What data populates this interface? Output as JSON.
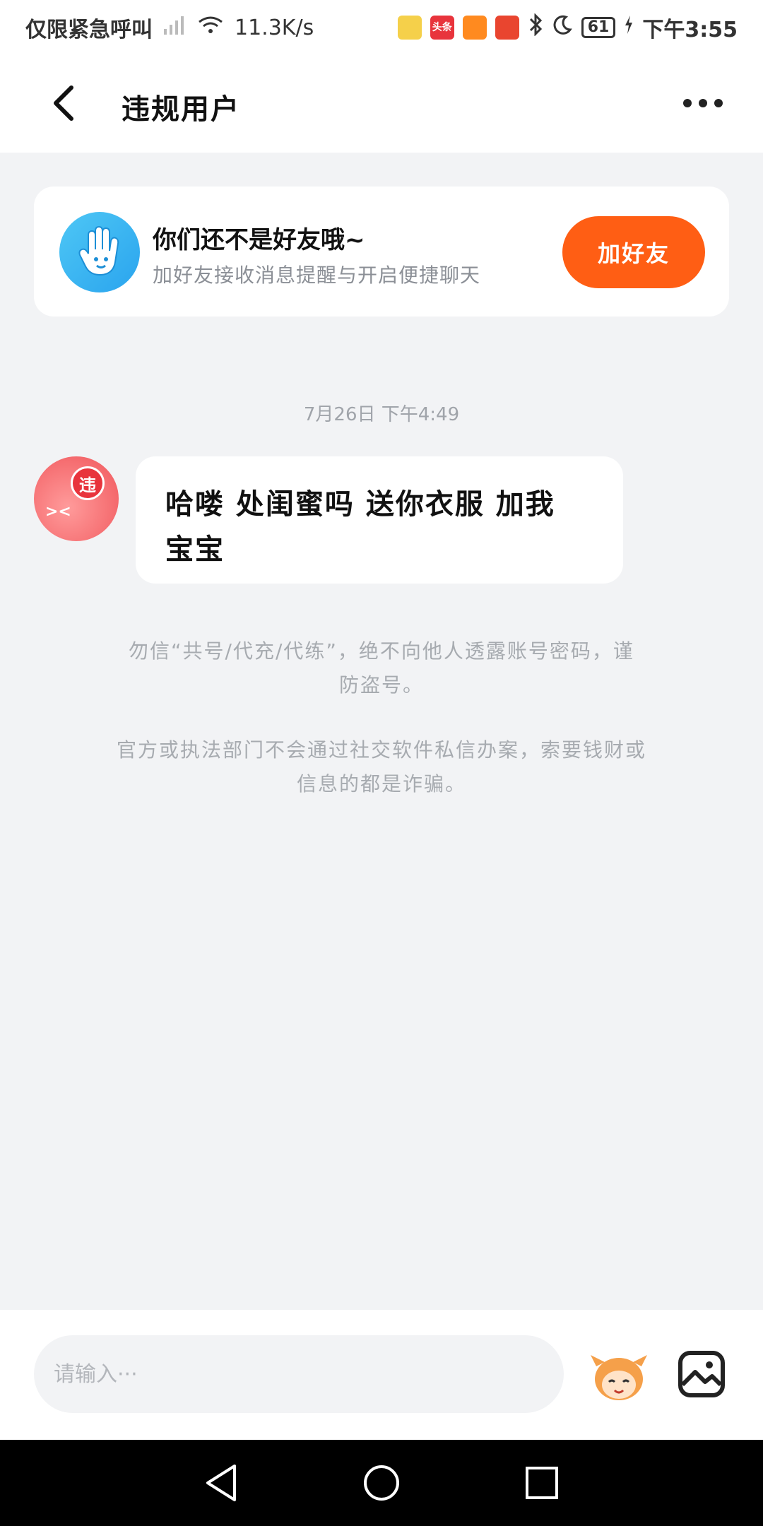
{
  "status_bar": {
    "carrier": "仅限紧急呼叫",
    "net_speed": "11.3K/s",
    "battery": "61",
    "time": "下午3:55",
    "apps": [
      "头条"
    ]
  },
  "header": {
    "title": "违规用户",
    "back_icon": "back-arrow-icon",
    "more_icon": "more-dots-icon"
  },
  "friend_card": {
    "title": "你们还不是好友哦~",
    "subtitle": "加好友接收消息提醒与开启便捷聊天",
    "button_label": "加好友"
  },
  "chat": {
    "timestamp": "7月26日  下午4:49",
    "messages": [
      {
        "sender_badge": "违",
        "text_line1": "哈喽 处闺蜜吗 送你衣服 加我",
        "text_line2": "宝宝"
      }
    ],
    "warning_1_line1": "勿信“共号/代充/代练”，绝不向他人透露账号密码，谨",
    "warning_1_line2": "防盗号。",
    "warning_2_line1": "官方或执法部门不会通过社交软件私信办案，索要钱财或",
    "warning_2_line2": "信息的都是诈骗。"
  },
  "input": {
    "placeholder": "请输入···"
  },
  "colors": {
    "accent": "#ff5e14",
    "background": "#f2f3f5",
    "avatar_blue": "#2aa4ee",
    "violation_red": "#e8343c"
  }
}
